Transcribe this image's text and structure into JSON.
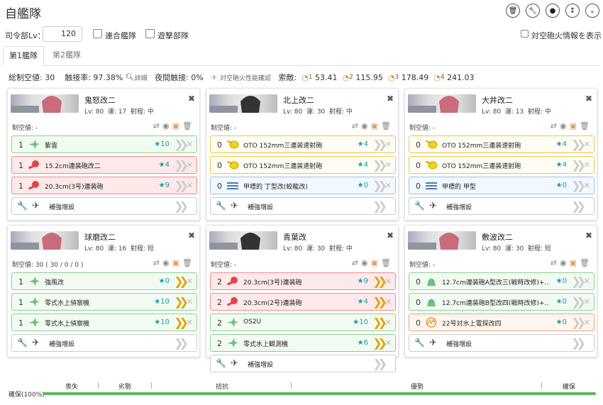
{
  "header": {
    "title": "自艦隊"
  },
  "toolbar": {
    "icons": [
      "trash-icon",
      "wrench-icon",
      "camera-icon",
      "sort-icon",
      "chevron-down-icon"
    ]
  },
  "settings": {
    "admiral_label": "司令部Lv：",
    "admiral_value": "120",
    "combined_label": "連合艦隊",
    "striking_label": "遊撃部隊",
    "aa_label": "対空砲火情報を表示"
  },
  "tabs": [
    {
      "label": "第1艦隊"
    },
    {
      "label": "第2艦隊"
    }
  ],
  "stats": {
    "air": "総制空値: 30",
    "contact": "触接率: 97.38%",
    "detail": "詳細",
    "night": "夜間触接: 0%",
    "aa_check": "対空砲火性能確認",
    "los_label": "索敵:",
    "los": [
      {
        "n": "1",
        "v": "53.41"
      },
      {
        "n": "2",
        "v": "115.95"
      },
      {
        "n": "3",
        "v": "178.49"
      },
      {
        "n": "4",
        "v": "241.03"
      }
    ]
  },
  "ships": [
    {
      "name": "鬼怒改二",
      "lv": "Lv: 80",
      "luck": "運: 17",
      "range": "射程: 中",
      "air": "制空値: -",
      "equip": [
        {
          "cnt": "1",
          "name": "紫雲",
          "star": "★10",
          "type": "green",
          "active": false
        },
        {
          "cnt": "1",
          "name": "15.2cm連装砲改二",
          "star": "★4",
          "type": "red",
          "active": false
        },
        {
          "cnt": "1",
          "name": "20.3cm(3号)連装砲",
          "star": "★9",
          "type": "red",
          "active": false
        }
      ],
      "extra": "補強増設"
    },
    {
      "name": "北上改二",
      "lv": "Lv: 80",
      "luck": "運: 30",
      "range": "射程: 中",
      "air": "制空値: -",
      "equip": [
        {
          "cnt": "0",
          "name": "OTO 152mm三連装速射砲",
          "star": "★4",
          "type": "yellow",
          "active": false
        },
        {
          "cnt": "0",
          "name": "OTO 152mm三連装速射砲",
          "star": "★4",
          "type": "yellow",
          "active": false
        },
        {
          "cnt": "0",
          "name": "甲標的 丁型改(蛟龍改)",
          "star": "★0",
          "type": "blue",
          "active": false
        }
      ],
      "extra": "補強増設"
    },
    {
      "name": "大井改二",
      "lv": "Lv: 80",
      "luck": "運: 13",
      "range": "射程: 中",
      "air": "制空値: -",
      "equip": [
        {
          "cnt": "0",
          "name": "OTO 152mm三連装速射砲",
          "star": "★4",
          "type": "yellow",
          "active": false
        },
        {
          "cnt": "0",
          "name": "OTO 152mm三連装速射砲",
          "star": "★4",
          "type": "yellow",
          "active": false
        },
        {
          "cnt": "0",
          "name": "甲標的 甲型",
          "star": "★0",
          "type": "blue",
          "active": false
        }
      ],
      "extra": "補強増設"
    },
    {
      "name": "球磨改二",
      "lv": "Lv: 80",
      "luck": "運: 16",
      "range": "射程: 短",
      "air": "制空値: 30 ( 30 / 0 / 0 )",
      "equip": [
        {
          "cnt": "1",
          "name": "強風改",
          "star": "★0",
          "type": "green",
          "active": true
        },
        {
          "cnt": "1",
          "name": "零式水上偵察機",
          "star": "★10",
          "type": "green",
          "active": true
        },
        {
          "cnt": "1",
          "name": "零式水上偵察機",
          "star": "★10",
          "type": "green",
          "active": true
        }
      ],
      "extra": "補強増設"
    },
    {
      "name": "青葉改",
      "lv": "Lv: 80",
      "luck": "運: 30",
      "range": "射程: 中",
      "air": "制空値: -",
      "equip": [
        {
          "cnt": "2",
          "name": "20.3cm(3号)連装砲",
          "star": "★9",
          "type": "red",
          "active": true
        },
        {
          "cnt": "2",
          "name": "20.3cm(2号)連装砲",
          "star": "★4",
          "type": "red",
          "active": true
        },
        {
          "cnt": "2",
          "name": "OS2U",
          "star": "★10",
          "type": "green",
          "active": true
        },
        {
          "cnt": "2",
          "name": "零式水上観測機",
          "star": "★6",
          "type": "green",
          "active": true
        }
      ],
      "extra": "補強増設"
    },
    {
      "name": "敷波改二",
      "lv": "Lv: 80",
      "luck": "運: 30",
      "range": "射程: 短",
      "air": "制空値: -",
      "equip": [
        {
          "cnt": "0",
          "name": "12.7cm連装砲A型改三(戦時改修)+…",
          "star": "★0",
          "type": "green",
          "active": false
        },
        {
          "cnt": "0",
          "name": "12.7cm連装砲B型改四(戦時改修)+…",
          "star": "★0",
          "type": "green",
          "active": false
        },
        {
          "cnt": "0",
          "name": "22号対水上電探改四",
          "star": "★0",
          "type": "orange",
          "active": false
        }
      ],
      "extra": "補強増設"
    }
  ],
  "airstate": {
    "labels": [
      "喪失",
      "劣勢",
      "拮抗",
      "優勢",
      "確保"
    ],
    "status": "確保(100%)"
  },
  "colors": {
    "green": "#5cb85c",
    "gun": "#e0454a",
    "yellow_icon": "#f2d21a",
    "blue_icon": "#4a78c2",
    "plane": "#6ec07a"
  }
}
